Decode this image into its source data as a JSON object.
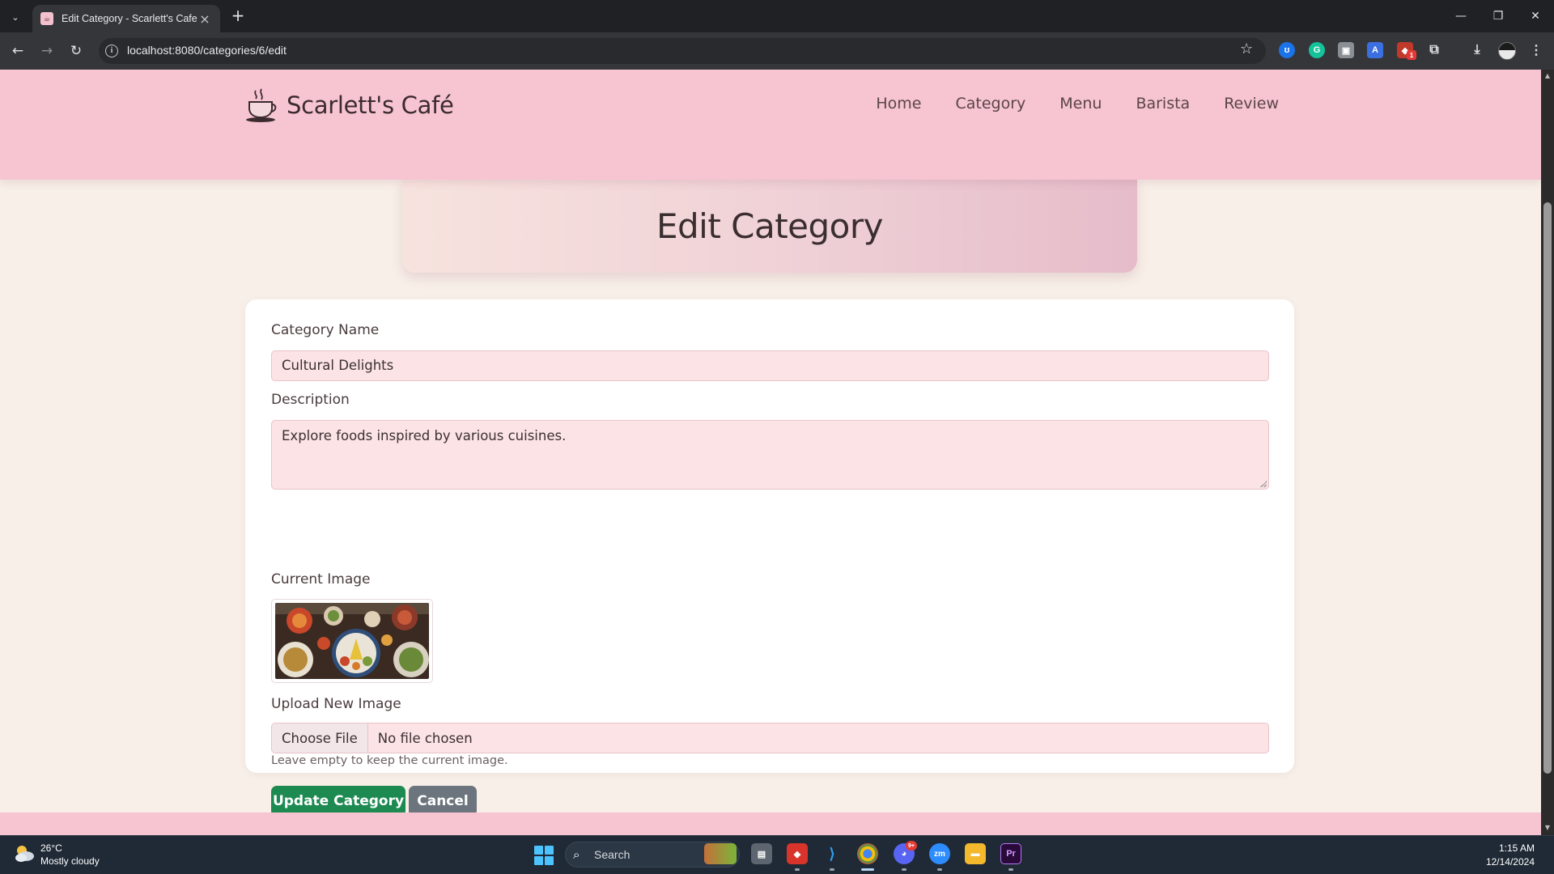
{
  "browser": {
    "tab_title": "Edit Category - Scarlett's Cafe",
    "url": "localhost:8080/categories/6/edit",
    "extension_badge": "1"
  },
  "site": {
    "brand": "Scarlett's Café",
    "nav": [
      "Home",
      "Category",
      "Menu",
      "Barista",
      "Review"
    ]
  },
  "page": {
    "title": "Edit Category"
  },
  "form": {
    "name_label": "Category Name",
    "name_value": "Cultural Delights",
    "description_label": "Description",
    "description_value": "Explore foods inspired by various cuisines.",
    "current_image_label": "Current Image",
    "upload_label": "Upload New Image",
    "choose_file": "Choose File",
    "file_status": "No file chosen",
    "upload_help": "Leave empty to keep the current image.",
    "update_button": "Update Category",
    "cancel_button": "Cancel"
  },
  "taskbar": {
    "weather_temp": "26°C",
    "weather_desc": "Mostly cloudy",
    "search_placeholder": "Search",
    "time": "1:15 AM",
    "date": "12/14/2024",
    "discord_badge": "9+"
  },
  "colors": {
    "header_pink": "#f7c4d2",
    "page_bg": "#f8efe8",
    "input_bg": "#fbe3e6",
    "update_green": "#1d8a52",
    "cancel_gray": "#6c757d"
  }
}
